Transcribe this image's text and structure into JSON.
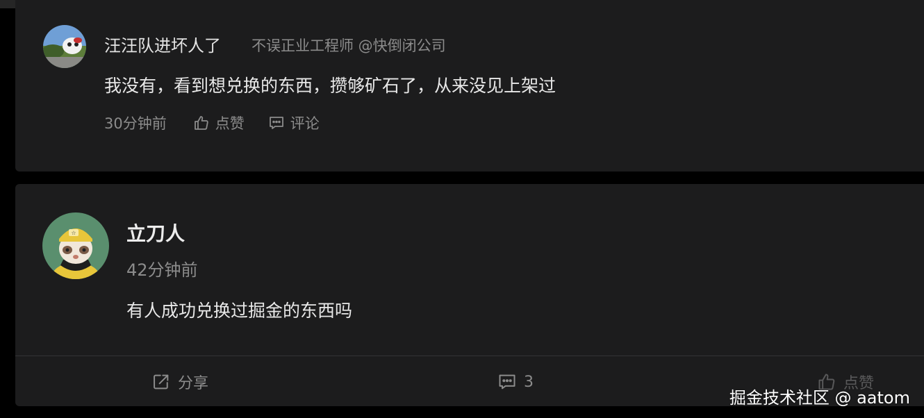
{
  "reply": {
    "author": "汪汪队进坏人了",
    "title": "不误正业工程师 @快倒闭公司",
    "content": "我没有，看到想兑换的东西，攒够矿石了，从来没见上架过",
    "time": "30分钟前",
    "like_label": "点赞",
    "comment_label": "评论"
  },
  "post": {
    "author": "立刀人",
    "time": "42分钟前",
    "content": "有人成功兑换过掘金的东西吗",
    "share_label": "分享",
    "comment_count": "3",
    "like_label": "点赞"
  },
  "watermark": "掘金技术社区 @ aatom",
  "colors": {
    "background": "#000000",
    "card": "#1c1c1d",
    "primary_text": "#e8e8e8",
    "secondary_text": "#8c8c8c",
    "divider": "#333335"
  },
  "icons": {
    "like": "thumbs-up-icon",
    "comment": "comment-bubble-icon",
    "share": "share-icon"
  }
}
